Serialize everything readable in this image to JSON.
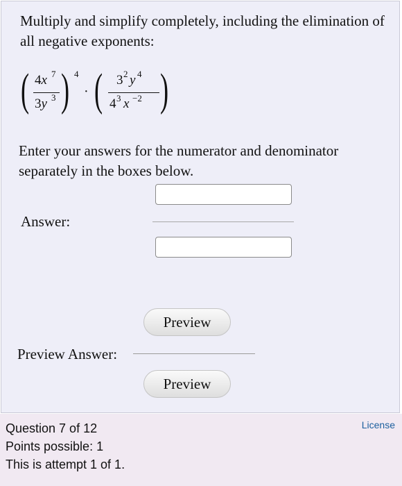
{
  "question": {
    "prompt": "Multiply and simplify completely, including the elimination of all negative exponents:",
    "instructions": "Enter your answers for the numerator and denominator separately in the boxes below.",
    "expression": {
      "first_factor": {
        "numerator_coef": "4",
        "numerator_var": "x",
        "numerator_exp": "7",
        "denominator_coef": "3",
        "denominator_var": "y",
        "denominator_exp": "3",
        "outer_exp": "4"
      },
      "dot": "·",
      "second_factor": {
        "num_base": "3",
        "num_base_exp": "2",
        "num_var": "y",
        "num_var_exp": "4",
        "den_base": "4",
        "den_base_exp": "3",
        "den_var": "x",
        "den_var_exp": "−2"
      }
    }
  },
  "answer": {
    "label": "Answer:",
    "numerator_value": "",
    "denominator_value": ""
  },
  "preview": {
    "button_label": "Preview",
    "answer_label": "Preview Answer:",
    "second_button_label": "Preview"
  },
  "footer": {
    "question_counter": "Question 7 of 12",
    "points": "Points possible: 1",
    "attempt": "This is attempt 1 of 1.",
    "license_link": "License",
    "link_color": "#1b5f9e"
  }
}
